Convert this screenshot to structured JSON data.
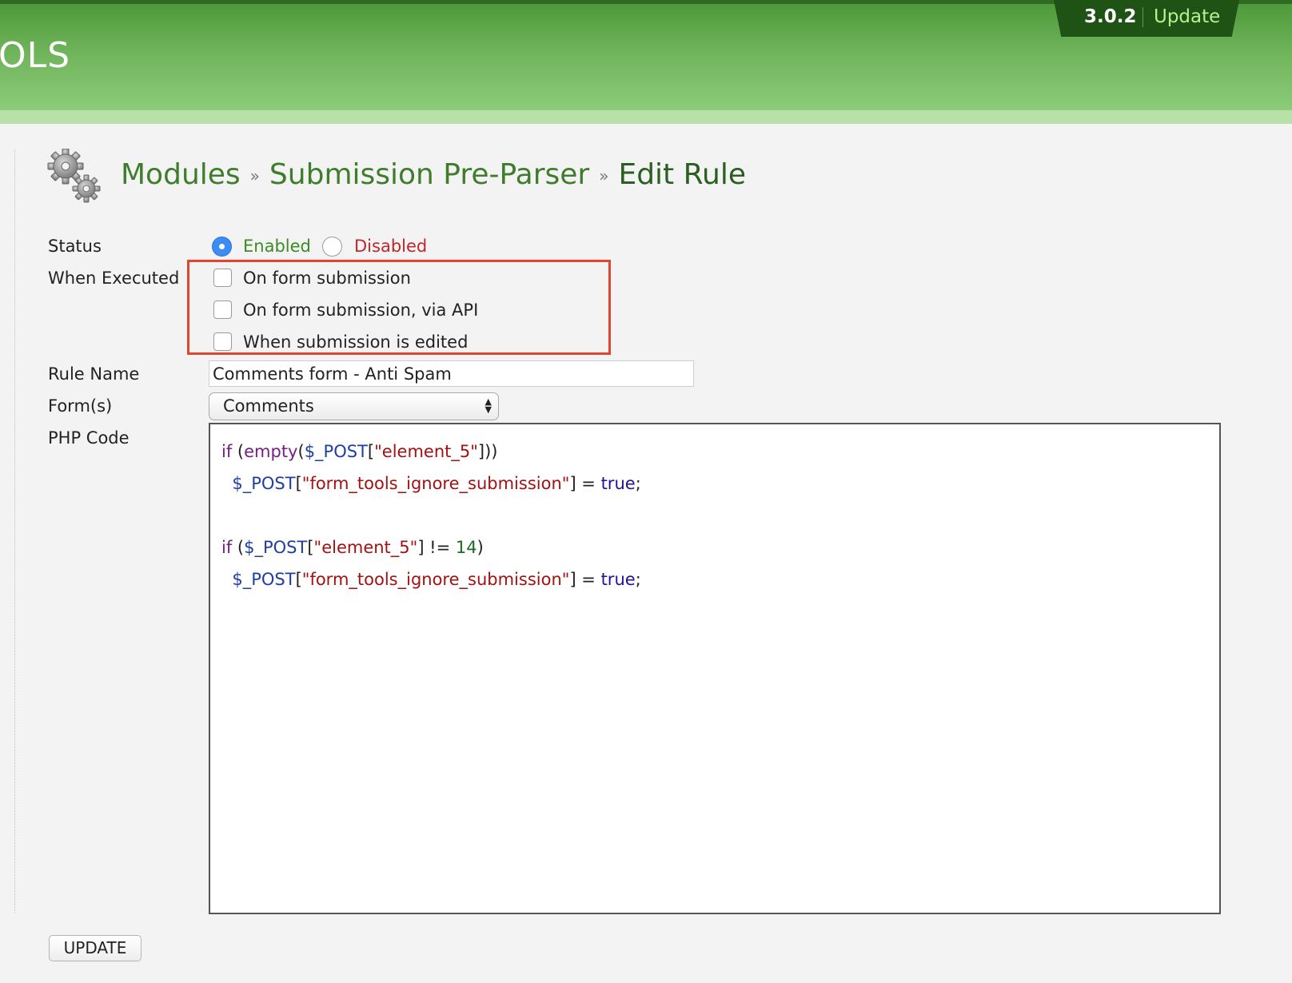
{
  "header": {
    "logo_text": "OLS",
    "version": "3.0.2",
    "update_label": "Update"
  },
  "breadcrumb": {
    "items": [
      "Modules",
      "Submission Pre-Parser"
    ],
    "separator": "»",
    "current": "Edit Rule"
  },
  "form": {
    "status": {
      "label": "Status",
      "options": [
        {
          "label": "Enabled",
          "selected": true
        },
        {
          "label": "Disabled",
          "selected": false
        }
      ]
    },
    "when_executed": {
      "label": "When Executed",
      "options": [
        {
          "label": "On form submission",
          "checked": false
        },
        {
          "label": "On form submission, via API",
          "checked": false
        },
        {
          "label": "When submission is edited",
          "checked": false
        }
      ]
    },
    "rule_name": {
      "label": "Rule Name",
      "value": "Comments form - Anti Spam"
    },
    "forms": {
      "label": "Form(s)",
      "selected": "Comments"
    },
    "php_code": {
      "label": "PHP Code",
      "lines": [
        "if (empty($_POST[\"element_5\"]))",
        "  $_POST[\"form_tools_ignore_submission\"] = true;",
        "",
        "if ($_POST[\"element_5\"] != 14)",
        "  $_POST[\"form_tools_ignore_submission\"] = true;"
      ]
    },
    "submit_label": "UPDATE"
  },
  "colors": {
    "header_green": "#6fb35a",
    "link_green": "#3f7d2c",
    "enabled_green": "#3b8c24",
    "disabled_red": "#c0262c",
    "highlight_red": "#e0452e",
    "radio_blue": "#3b8cf4"
  },
  "icons": {
    "page_icon": "gears-icon",
    "select_icon": "up-down-arrows-icon"
  }
}
